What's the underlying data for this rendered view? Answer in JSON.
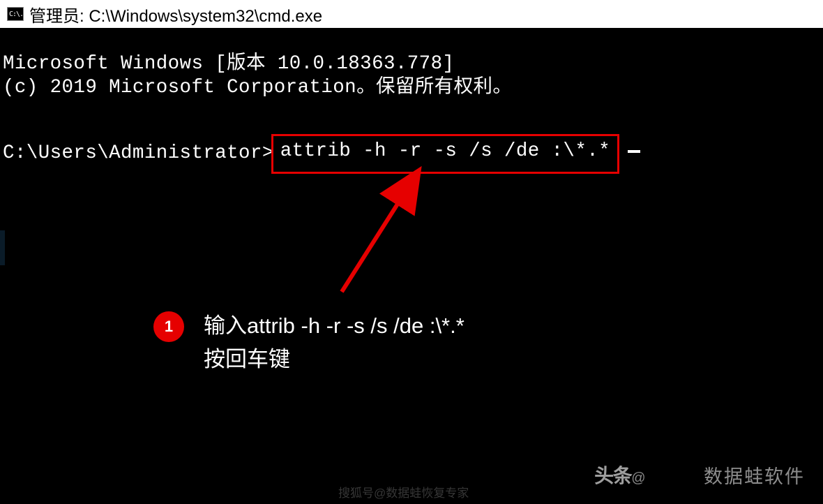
{
  "titleBar": {
    "iconText": "C:\\.",
    "title": "管理员: C:\\Windows\\system32\\cmd.exe"
  },
  "terminal": {
    "line1": "Microsoft Windows [版本 10.0.18363.778]",
    "line2": "(c) 2019 Microsoft Corporation。保留所有权利。",
    "promptPrefix": "C:\\Users\\Administrator>",
    "command": "attrib -h -r -s /s /de :\\*.*"
  },
  "annotation": {
    "stepNumber": "1",
    "line1": "输入attrib -h -r -s /s /de :\\*.*",
    "line2": "按回车键"
  },
  "watermarks": {
    "toutiaoPrefix": "头条",
    "toutiaoAt": "@",
    "rightText": "数据蛙软件",
    "bottomText": "搜狐号@数据蛙恢复专家"
  }
}
